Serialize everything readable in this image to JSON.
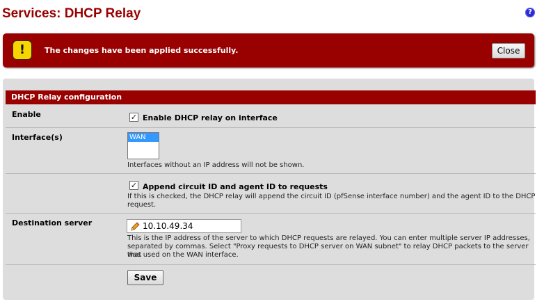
{
  "page": {
    "title": "Services: DHCP Relay",
    "help_icon": "question-icon"
  },
  "alert": {
    "icon": "warning-icon",
    "message": "The changes have been applied successfully.",
    "close_label": "Close"
  },
  "panel": {
    "header": "DHCP Relay configuration",
    "enable": {
      "label": "Enable",
      "checkbox_label": "Enable DHCP relay on interface",
      "checked": true
    },
    "interfaces": {
      "label": "Interface(s)",
      "options": [
        "WAN"
      ],
      "selected": "WAN",
      "help": "Interfaces without an IP address will not be shown."
    },
    "agent_option": {
      "checkbox_label": "Append circuit ID and agent ID to requests",
      "checked": true,
      "help_line1": "If this is checked, the DHCP relay will append the circuit ID (pfSense interface number) and the agent ID to the DHCP",
      "help_line2": "request."
    },
    "destination": {
      "label": "Destination server",
      "value": "10.10.49.34",
      "help_line1": "This is the IP address of the server to which DHCP requests are relayed. You can enter multiple server IP addresses,",
      "help_line2": "separated by commas. Select \"Proxy requests to DHCP server on WAN subnet\" to relay DHCP packets to the server that",
      "help_line3": "was used on the WAN interface."
    },
    "save_label": "Save"
  },
  "colors": {
    "brand_red": "#990000",
    "panel_bg": "#dddddd",
    "selection_blue": "#3399ff"
  }
}
